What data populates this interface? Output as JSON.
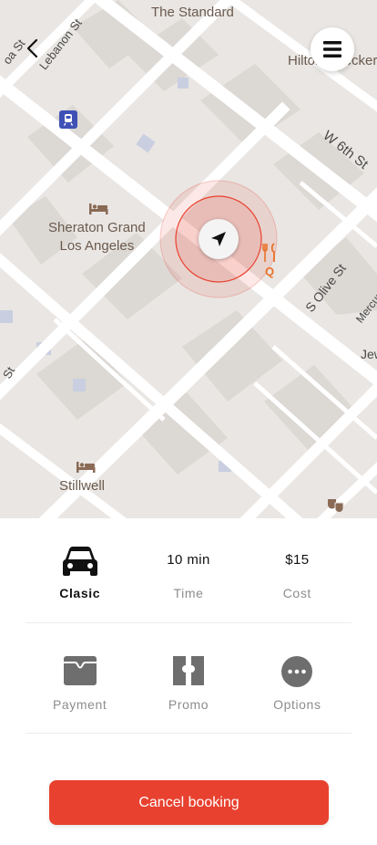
{
  "map": {
    "labels": {
      "the_standard": "The Standard",
      "hilton": "Hilton Checker",
      "sheraton_line1": "Sheraton Grand",
      "sheraton_line2": "Los Angeles",
      "stillwell": "Stillwell",
      "restaurant_q": "Q"
    },
    "streets": {
      "lebanon": "Lebanon St",
      "w6th": "W 6th St",
      "olive": "S Olive St",
      "mercury": "Mercury",
      "top_left": "oa St",
      "left_edge": "St",
      "jew": "Jew"
    }
  },
  "ride": {
    "vehicle_label": "Clasic",
    "time_value": "10 min",
    "time_label": "Time",
    "cost_value": "$15",
    "cost_label": "Cost"
  },
  "actions": {
    "payment_label": "Payment",
    "promo_label": "Promo",
    "options_label": "Options"
  },
  "cancel_label": "Cancel booking",
  "colors": {
    "accent": "#e8412f",
    "map_bg": "#e9e6e3",
    "road": "#ffffff",
    "building": "#dedad6"
  }
}
